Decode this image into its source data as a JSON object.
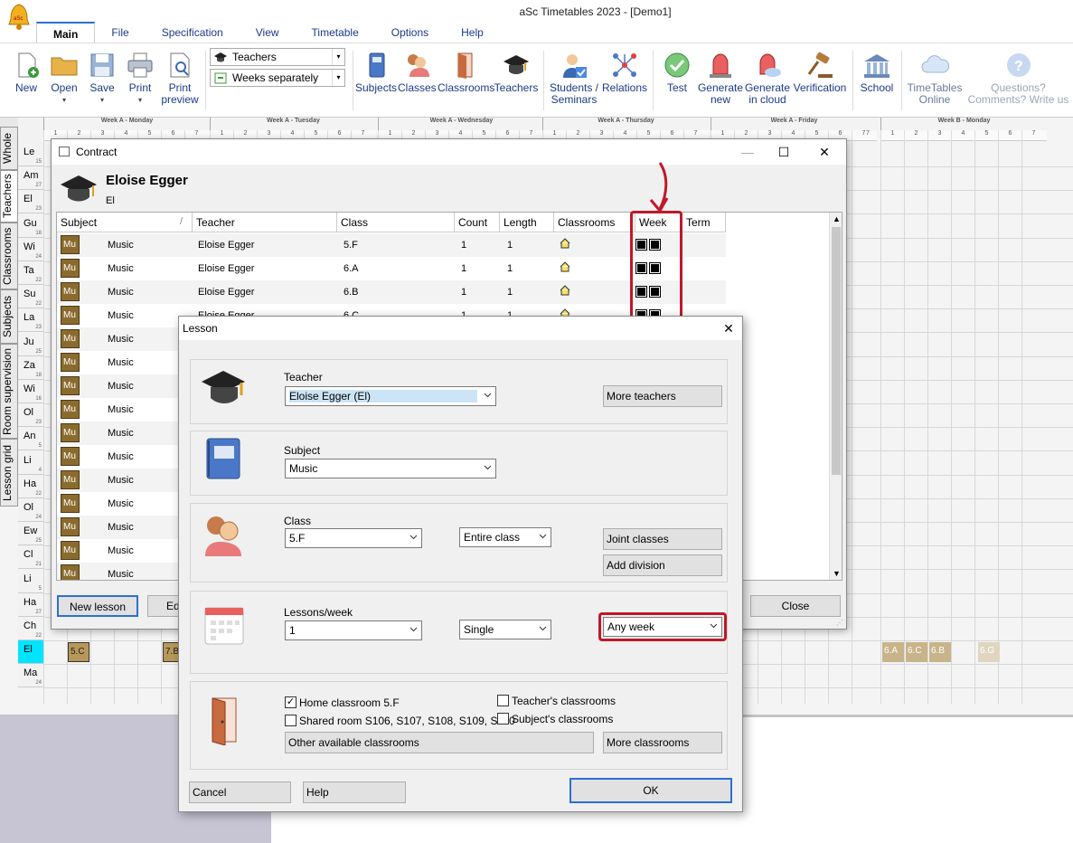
{
  "app": {
    "title": "aSc Timetables 2023  - [Demo1]"
  },
  "menu": {
    "tabs": [
      "Main",
      "File",
      "Specification",
      "View",
      "Timetable",
      "Options",
      "Help"
    ]
  },
  "ribbon": {
    "new": "New",
    "open": "Open",
    "save": "Save",
    "print": "Print",
    "print_preview_1": "Print",
    "print_preview_2": "preview",
    "view_select": "Teachers",
    "weeks_select": "Weeks separately",
    "subjects": "Subjects",
    "classes": "Classes",
    "classrooms": "Classrooms",
    "teachers": "Teachers",
    "students_1": "Students /",
    "students_2": "Seminars",
    "relations": "Relations",
    "test": "Test",
    "generate_new_1": "Generate",
    "generate_new_2": "new",
    "generate_cloud_1": "Generate",
    "generate_cloud_2": "in cloud",
    "verification": "Verification",
    "school": "School",
    "online_1": "TimeTables",
    "online_2": "Online",
    "questions_1": "Questions?",
    "questions_2": "Comments? Write us"
  },
  "side_tabs": [
    "Whole",
    "Teachers",
    "Classrooms",
    "Subjects",
    "Room supervision",
    "Lesson grid"
  ],
  "grid": {
    "days": [
      "Week A - Monday",
      "Week A - Tuesday",
      "Week A - Wednesday",
      "Week A - Thursday",
      "Week A - Friday",
      "Week B - Monday"
    ],
    "period_numbers": [
      "1",
      "2",
      "3",
      "4",
      "5",
      "6",
      "7"
    ],
    "last_period_label": "7",
    "rows": [
      {
        "short": "Le",
        "count": "15"
      },
      {
        "short": "Am",
        "count": "27"
      },
      {
        "short": "El",
        "count": "23"
      },
      {
        "short": "Gu",
        "count": "18"
      },
      {
        "short": "Wi",
        "count": "24"
      },
      {
        "short": "Ta",
        "count": "22"
      },
      {
        "short": "Su",
        "count": "22"
      },
      {
        "short": "La",
        "count": "23"
      },
      {
        "short": "Ju",
        "count": "25"
      },
      {
        "short": "Za",
        "count": "18"
      },
      {
        "short": "Wi",
        "count": "16"
      },
      {
        "short": "Ol",
        "count": "23"
      },
      {
        "short": "An",
        "count": "5"
      },
      {
        "short": "Li",
        "count": "4"
      },
      {
        "short": "Ha",
        "count": "22"
      },
      {
        "short": "Ol",
        "count": "24"
      },
      {
        "short": "Ew",
        "count": "25"
      },
      {
        "short": "Cl",
        "count": "21"
      },
      {
        "short": "Li",
        "count": "5"
      },
      {
        "short": "Ha",
        "count": "27"
      },
      {
        "short": "Ch",
        "count": "22"
      },
      {
        "short": "El",
        "count": ""
      },
      {
        "short": "Ma",
        "count": "24"
      }
    ],
    "el_row_cells": [
      "5.C",
      "7.B"
    ],
    "week_b_cells": [
      "6.A",
      "6.C",
      "6.B",
      "6.G"
    ]
  },
  "contract": {
    "title": "Contract",
    "teacher_name": "Eloise Egger",
    "teacher_short": "El",
    "columns": [
      "Subject",
      "Teacher",
      "Class",
      "Count",
      "Length",
      "Classrooms",
      "Week",
      "Term"
    ],
    "rows": [
      {
        "abbr": "Mu",
        "subject": "Music",
        "teacher": "Eloise Egger",
        "class": "5.F",
        "count": "1",
        "length": "1"
      },
      {
        "abbr": "Mu",
        "subject": "Music",
        "teacher": "Eloise Egger",
        "class": "6.A",
        "count": "1",
        "length": "1"
      },
      {
        "abbr": "Mu",
        "subject": "Music",
        "teacher": "Eloise Egger",
        "class": "6.B",
        "count": "1",
        "length": "1"
      },
      {
        "abbr": "Mu",
        "subject": "Music",
        "teacher": "Eloise Egger",
        "class": "6.C",
        "count": "1",
        "length": "1"
      },
      {
        "abbr": "Mu",
        "subject": "Music"
      },
      {
        "abbr": "Mu",
        "subject": "Music"
      },
      {
        "abbr": "Mu",
        "subject": "Music"
      },
      {
        "abbr": "Mu",
        "subject": "Music"
      },
      {
        "abbr": "Mu",
        "subject": "Music"
      },
      {
        "abbr": "Mu",
        "subject": "Music"
      },
      {
        "abbr": "Mu",
        "subject": "Music"
      },
      {
        "abbr": "Mu",
        "subject": "Music"
      },
      {
        "abbr": "Mu",
        "subject": "Music"
      },
      {
        "abbr": "Mu",
        "subject": "Music"
      },
      {
        "abbr": "Mu",
        "subject": "Music"
      }
    ],
    "new_lesson": "New lesson",
    "edit": "Edi",
    "close": "Close"
  },
  "lesson": {
    "title": "Lesson",
    "teacher_label": "Teacher",
    "teacher_value": "Eloise Egger (El)",
    "more_teachers": "More teachers",
    "subject_label": "Subject",
    "subject_value": "Music",
    "class_label": "Class",
    "class_value": "5.F",
    "group_value": "Entire class",
    "joint_classes": "Joint classes",
    "add_division": "Add division",
    "lessons_week_label": "Lessons/week",
    "lessons_week_value": "1",
    "length_value": "Single",
    "week_value": "Any week",
    "home_classroom": "Home classroom 5.F",
    "teachers_classrooms": "Teacher's classrooms",
    "shared_room": "Shared room S106, S107, S108, S109, S110",
    "subjects_classrooms": "Subject's classrooms",
    "other_classrooms": "Other available classrooms",
    "more_classrooms": "More classrooms",
    "cancel": "Cancel",
    "help": "Help",
    "ok": "OK"
  },
  "colors": {
    "accent": "#2c6fd1",
    "annotation": "#c0182a",
    "music": "#8b6b2d",
    "highlight_row": "#00e5ff"
  }
}
